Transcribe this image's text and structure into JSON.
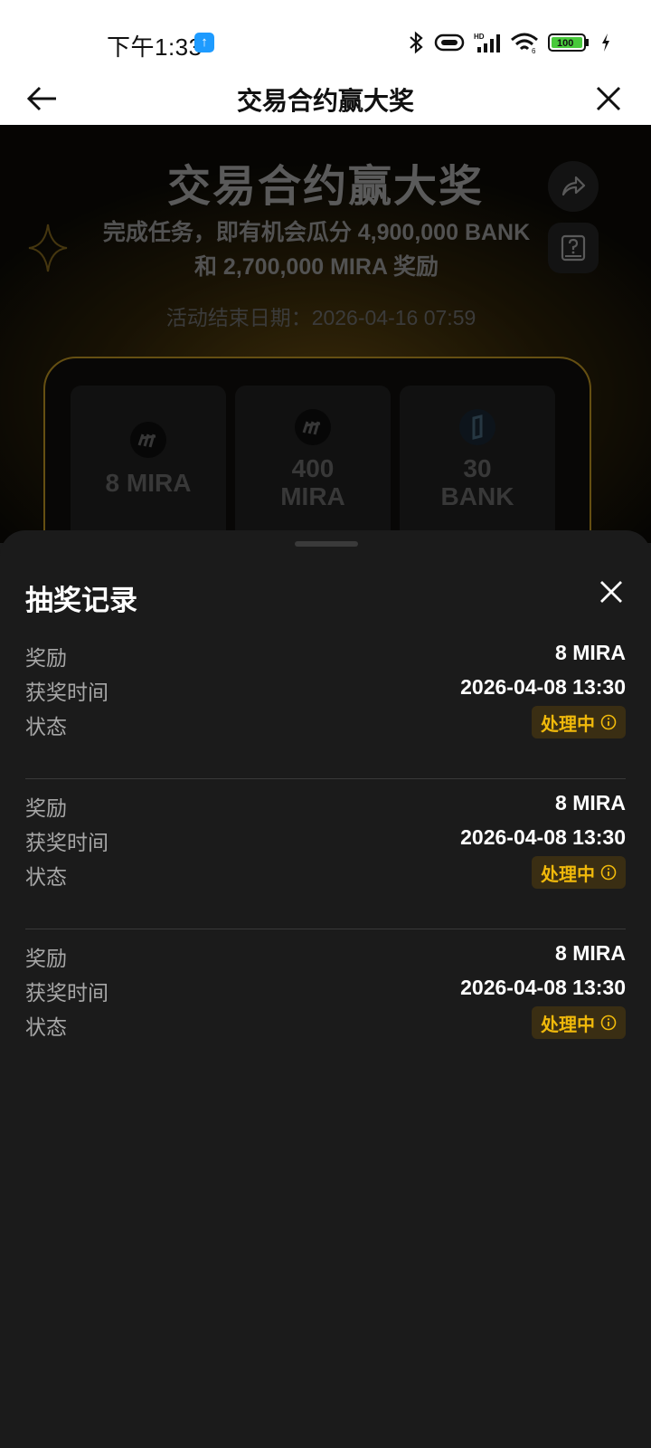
{
  "status_bar": {
    "time": "下午1:33",
    "upload_icon": "upload-arrow-icon",
    "battery": "100"
  },
  "nav": {
    "title": "交易合约赢大奖",
    "back_icon": "arrow-left-icon",
    "close_icon": "close-icon"
  },
  "hero": {
    "title": "交易合约赢大奖",
    "subtitle": "完成任务，即有机会瓜分 4,900,000 BANK 和 2,700,000 MIRA 奖励",
    "end_date": "活动结束日期：2026-04-16 07:59"
  },
  "prizes": [
    {
      "label": "8 MIRA",
      "icon": "mira-token-icon"
    },
    {
      "label": "400 MIRA",
      "icon": "mira-token-icon"
    },
    {
      "label": "30 BANK",
      "icon": "bank-token-icon"
    }
  ],
  "sheet": {
    "title": "抽奖记录",
    "records": [
      {
        "reward_label": "奖励",
        "reward": "8 MIRA",
        "time_label": "获奖时间",
        "time": "2026-04-08 13:30",
        "status_label": "状态",
        "status": "处理中"
      },
      {
        "reward_label": "奖励",
        "reward": "8 MIRA",
        "time_label": "获奖时间",
        "time": "2026-04-08 13:30",
        "status_label": "状态",
        "status": "处理中"
      },
      {
        "reward_label": "奖励",
        "reward": "8 MIRA",
        "time_label": "获奖时间",
        "time": "2026-04-08 13:30",
        "status_label": "状态",
        "status": "处理中"
      }
    ]
  },
  "colors": {
    "accent": "#f0b90b",
    "sheet_bg": "#1b1b1b",
    "badge_bg": "#3a2e13"
  }
}
